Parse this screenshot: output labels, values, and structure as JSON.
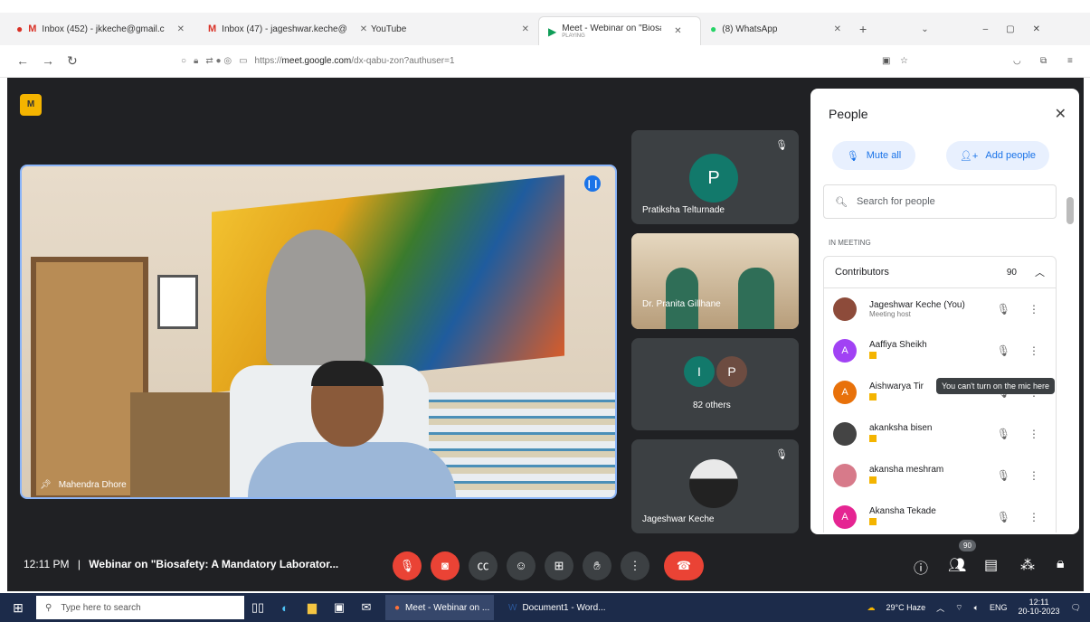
{
  "browser": {
    "tabs": [
      {
        "label": "Inbox (452) - jkkeche@gmail.c",
        "icon": "gmail-icon",
        "active": false
      },
      {
        "label": "Inbox (47) - jageshwar.keche@",
        "icon": "gmail-icon",
        "active": false
      },
      {
        "label": "YouTube",
        "icon": "none",
        "active": false
      },
      {
        "label": "Meet - Webinar on \"Biosafety: A",
        "sub": "PLAYING",
        "icon": "meet-icon",
        "active": true
      },
      {
        "label": "(8) WhatsApp",
        "icon": "whatsapp-icon",
        "active": false
      }
    ],
    "url_prefix": "https://",
    "url_domain": "meet.google.com",
    "url_path": "/dx-qabu-zon?authuser=1"
  },
  "tiles": {
    "main_name": "Mahendra Dhore",
    "t1_initial": "P",
    "t1_name": "Pratiksha Telturnade",
    "t2_name": "Dr. Pranita Gillhane",
    "t3_initial_a": "I",
    "t3_initial_b": "P",
    "t3_name": "82 others",
    "t4_name": "Jageshwar Keche"
  },
  "people": {
    "title": "People",
    "mute_all": "Mute all",
    "add_people": "Add people",
    "search_placeholder": "Search for people",
    "in_meeting": "IN MEETING",
    "contributors": "Contributors",
    "count": "90",
    "rows": [
      {
        "name": "Jageshwar Keche (You)",
        "sub": "Meeting host",
        "initial": "",
        "color": "#8d4b3a"
      },
      {
        "name": "Aaffiya Sheikh",
        "sub": "",
        "initial": "A",
        "color": "#a142f4"
      },
      {
        "name": "Aishwarya Tir",
        "sub": "",
        "initial": "A",
        "color": "#e8710a"
      },
      {
        "name": "akanksha bisen",
        "sub": "",
        "initial": "",
        "color": "#444444"
      },
      {
        "name": "akansha meshram",
        "sub": "",
        "initial": "",
        "color": "#d77a8a"
      },
      {
        "name": "Akansha Tekade",
        "sub": "",
        "initial": "A",
        "color": "#e52592"
      }
    ],
    "tooltip": "You can't turn on the mic here"
  },
  "bottom": {
    "time": "12:11 PM",
    "separator": "|",
    "title": "Webinar on \"Biosafety: A Mandatory Laborator...",
    "people_badge": "90"
  },
  "taskbar": {
    "search": "Type here to search",
    "app1": "Meet - Webinar on ...",
    "app2": "Document1 - Word...",
    "weather": "29°C Haze",
    "lang": "ENG",
    "time": "12:11",
    "date": "20-10-2023"
  }
}
